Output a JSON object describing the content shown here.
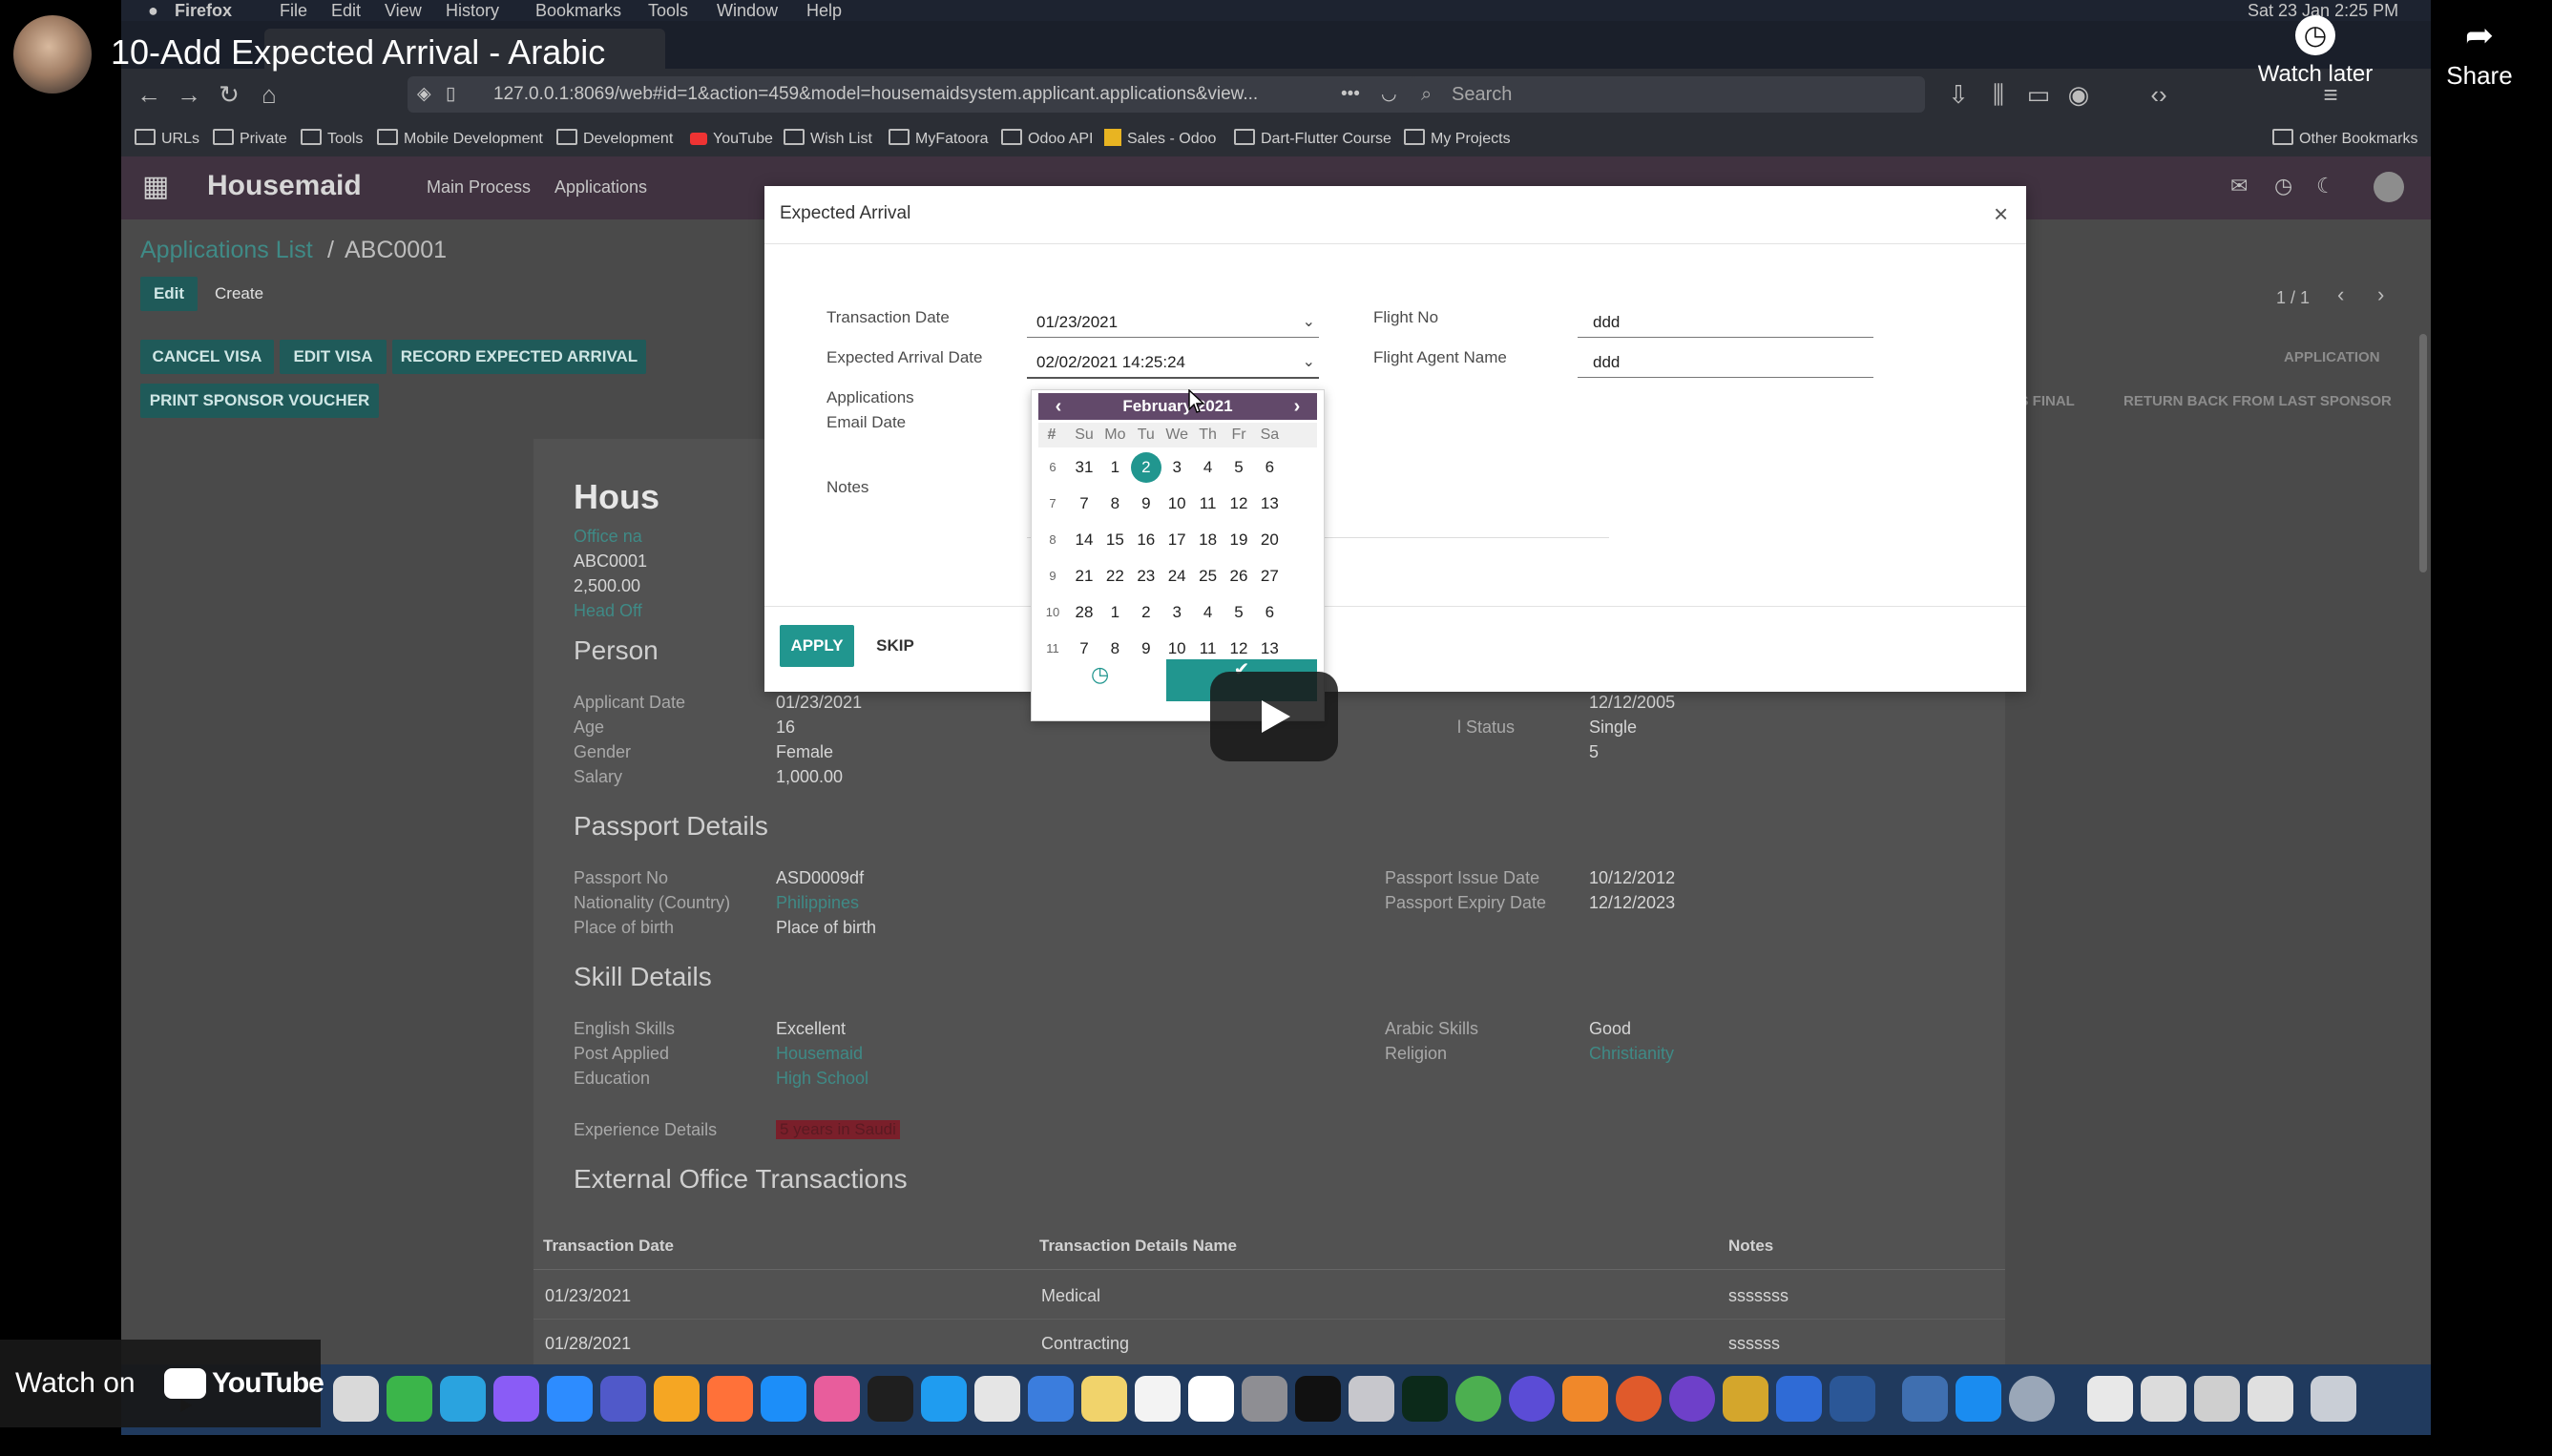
{
  "youtube": {
    "title": "10-Add Expected Arrival - Arabic",
    "watch_later": "Watch later",
    "share": "Share",
    "watch_on": "Watch on",
    "youtube_brand": "YouTube"
  },
  "mac_menu": {
    "app": "Firefox",
    "items": [
      "File",
      "Edit",
      "View",
      "History",
      "Bookmarks",
      "Tools",
      "Window",
      "Help"
    ],
    "clock": "Sat 23 Jan  2:25 PM"
  },
  "browser": {
    "url": "127.0.0.1:8069/web#id=1&action=459&model=housemaidsystem.applicant.applications&view...",
    "search_placeholder": "Search",
    "bookmarks": [
      "URLs",
      "Private",
      "Tools",
      "Mobile Development",
      "Development",
      "YouTube",
      "Wish List",
      "MyFatoora",
      "Odoo API",
      "Sales - Odoo",
      "Dart-Flutter Course",
      "My Projects"
    ],
    "other_bookmarks": "Other Bookmarks"
  },
  "app": {
    "name": "Housemaid",
    "menu": [
      "Main Process",
      "Applications"
    ],
    "breadcrumb_parent": "Applications List",
    "breadcrumb_sep": "/",
    "breadcrumb_current": "ABC0001",
    "edit": "Edit",
    "create": "Create",
    "pager": "1 / 1",
    "action_buttons": [
      "CANCEL VISA",
      "EDIT VISA",
      "RECORD EXPECTED ARRIVAL"
    ],
    "print_button": "PRINT SPONSOR VOUCHER",
    "status_steps": [
      "APPLICATION",
      "SELL AS FINAL",
      "RETURN BACK FROM LAST SPONSOR"
    ]
  },
  "sheet": {
    "title": "Hous",
    "lines": [
      "Office na",
      "ABC0001",
      "2,500.00",
      "Head Off"
    ],
    "personal": {
      "section": "Person",
      "left": [
        {
          "label": "Applicant Date",
          "value": "01/23/2021"
        },
        {
          "label": "Age",
          "value": "16"
        },
        {
          "label": "Gender",
          "value": "Female"
        },
        {
          "label": "Salary",
          "value": "1,000.00"
        }
      ],
      "right_values": [
        "12/12/2005",
        "Single",
        "5"
      ],
      "right_partial_label": "l Status"
    },
    "passport": {
      "section": "Passport Details",
      "left": [
        {
          "label": "Passport No",
          "value": "ASD0009df"
        },
        {
          "label": "Nationality (Country)",
          "value": "Philippines"
        },
        {
          "label": "Place of birth",
          "value": "Place of birth"
        }
      ],
      "right": [
        {
          "label": "Passport Issue Date",
          "value": "10/12/2012"
        },
        {
          "label": "Passport Expiry Date",
          "value": "12/12/2023"
        }
      ]
    },
    "skills": {
      "section": "Skill Details",
      "left": [
        {
          "label": "English Skills",
          "value": "Excellent"
        },
        {
          "label": "Post Applied",
          "value": "Housemaid"
        },
        {
          "label": "Education",
          "value": "High School"
        }
      ],
      "right": [
        {
          "label": "Arabic Skills",
          "value": "Good"
        },
        {
          "label": "Religion",
          "value": "Christianity"
        }
      ],
      "experience_label": "Experience Details",
      "experience_value": "5 years in Saudi"
    },
    "transactions": {
      "section": "External Office Transactions",
      "columns": [
        "Transaction Date",
        "Transaction Details Name",
        "Notes"
      ],
      "rows": [
        [
          "01/23/2021",
          "Medical",
          "sssssss"
        ],
        [
          "01/28/2021",
          "Contracting",
          "ssssss"
        ]
      ]
    }
  },
  "modal": {
    "title": "Expected Arrival",
    "close": "×",
    "transaction_date_label": "Transaction Date",
    "transaction_date_value": "01/23/2021",
    "expected_arrival_label": "Expected Arrival Date",
    "expected_arrival_value": "02/02/2021 14:25:24",
    "applications_label": "Applications",
    "email_date_label": "Email Date",
    "notes_label": "Notes",
    "flight_no_label": "Flight No",
    "flight_no_value": "ddd",
    "flight_agent_label": "Flight Agent Name",
    "flight_agent_value": "ddd",
    "apply": "APPLY",
    "skip": "SKIP"
  },
  "calendar": {
    "month": "February 2021",
    "week_header": "#",
    "dow": [
      "Su",
      "Mo",
      "Tu",
      "We",
      "Th",
      "Fr",
      "Sa"
    ],
    "weeks": [
      {
        "no": "6",
        "days": [
          "31",
          "1",
          "2",
          "3",
          "4",
          "5",
          "6"
        ]
      },
      {
        "no": "7",
        "days": [
          "7",
          "8",
          "9",
          "10",
          "11",
          "12",
          "13"
        ]
      },
      {
        "no": "8",
        "days": [
          "14",
          "15",
          "16",
          "17",
          "18",
          "19",
          "20"
        ]
      },
      {
        "no": "9",
        "days": [
          "21",
          "22",
          "23",
          "24",
          "25",
          "26",
          "27"
        ]
      },
      {
        "no": "10",
        "days": [
          "28",
          "1",
          "2",
          "3",
          "4",
          "5",
          "6"
        ]
      },
      {
        "no": "11",
        "days": [
          "7",
          "8",
          "9",
          "10",
          "11",
          "12",
          "13"
        ]
      }
    ],
    "selected": "2",
    "confirm_icon": "check-icon",
    "time_icon": "clock-icon"
  },
  "colors": {
    "odoo_purple": "#62496a",
    "odoo_teal": "#21968f",
    "dock_blue": "#203a5e"
  }
}
